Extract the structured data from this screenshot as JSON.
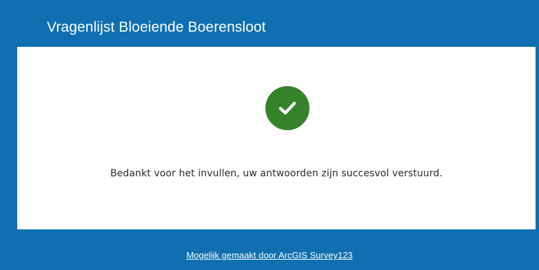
{
  "header": {
    "title": "Vragenlijst Bloeiende Boerensloot"
  },
  "confirmation": {
    "icon": "checkmark-icon",
    "message": "Bedankt voor het invullen, uw antwoorden zijn succesvol verstuurd."
  },
  "footer": {
    "link_text": "Mogelijk gemaakt door ArcGIS Survey123"
  },
  "colors": {
    "background": "#0f6fb0",
    "card": "#ffffff",
    "success": "#35822a"
  }
}
